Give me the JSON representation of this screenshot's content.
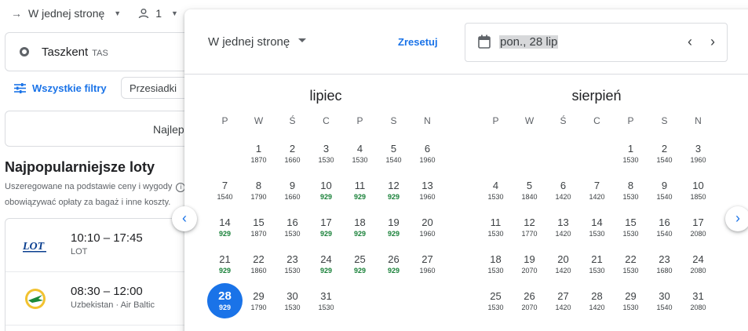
{
  "topbar": {
    "trip_type": "W jednej stronę",
    "passengers": "1"
  },
  "search": {
    "origin_city": "Taszkent",
    "origin_code": "TAS"
  },
  "filters": {
    "all_filters": "Wszystkie filtry",
    "stops_chip": "Przesiadki"
  },
  "sort": {
    "best_label": "Najlep"
  },
  "popular": {
    "title": "Najpopularniejsze loty",
    "subtitle_1": "Uszeregowane na podstawie ceny i wygody",
    "subtitle_2": "obowiązywać opłaty za bagaż i inne koszty."
  },
  "flights": [
    {
      "times": "10:10 – 17:45",
      "airline": "LOT",
      "logo": "lot-logo"
    },
    {
      "times": "08:30 – 12:00",
      "airline": "Uzbekistan · Air Baltic",
      "logo": "uzbekistan-airways-logo"
    }
  ],
  "calendar": {
    "trip_type": "W jednej stronę",
    "reset": "Zresetuj",
    "selected_date": "pon., 28 lip",
    "weekdays": [
      "P",
      "W",
      "Ś",
      "C",
      "P",
      "S",
      "N"
    ],
    "colors": {
      "accent": "#1a73e8",
      "cheap": "#188038"
    },
    "months": [
      {
        "name": "lipiec",
        "offset": 1,
        "days": [
          {
            "d": "1",
            "p": "1870"
          },
          {
            "d": "2",
            "p": "1660"
          },
          {
            "d": "3",
            "p": "1530"
          },
          {
            "d": "4",
            "p": "1530"
          },
          {
            "d": "5",
            "p": "1540"
          },
          {
            "d": "6",
            "p": "1960"
          },
          {
            "d": "7",
            "p": "1540"
          },
          {
            "d": "8",
            "p": "1790"
          },
          {
            "d": "9",
            "p": "1660"
          },
          {
            "d": "10",
            "p": "929",
            "cheap": true
          },
          {
            "d": "11",
            "p": "929",
            "cheap": true
          },
          {
            "d": "12",
            "p": "929",
            "cheap": true
          },
          {
            "d": "13",
            "p": "1960"
          },
          {
            "d": "14",
            "p": "929",
            "cheap": true
          },
          {
            "d": "15",
            "p": "1870"
          },
          {
            "d": "16",
            "p": "1530"
          },
          {
            "d": "17",
            "p": "929",
            "cheap": true
          },
          {
            "d": "18",
            "p": "929",
            "cheap": true
          },
          {
            "d": "19",
            "p": "929",
            "cheap": true
          },
          {
            "d": "20",
            "p": "1960"
          },
          {
            "d": "21",
            "p": "929",
            "cheap": true
          },
          {
            "d": "22",
            "p": "1860"
          },
          {
            "d": "23",
            "p": "1530"
          },
          {
            "d": "24",
            "p": "929",
            "cheap": true
          },
          {
            "d": "25",
            "p": "929",
            "cheap": true
          },
          {
            "d": "26",
            "p": "929",
            "cheap": true
          },
          {
            "d": "27",
            "p": "1960"
          },
          {
            "d": "28",
            "p": "929",
            "selected": true
          },
          {
            "d": "29",
            "p": "1790"
          },
          {
            "d": "30",
            "p": "1530"
          },
          {
            "d": "31",
            "p": "1530"
          }
        ]
      },
      {
        "name": "sierpień",
        "offset": 4,
        "days": [
          {
            "d": "1",
            "p": "1530"
          },
          {
            "d": "2",
            "p": "1540"
          },
          {
            "d": "3",
            "p": "1960"
          },
          {
            "d": "4",
            "p": "1530"
          },
          {
            "d": "5",
            "p": "1840"
          },
          {
            "d": "6",
            "p": "1420"
          },
          {
            "d": "7",
            "p": "1420"
          },
          {
            "d": "8",
            "p": "1530"
          },
          {
            "d": "9",
            "p": "1540"
          },
          {
            "d": "10",
            "p": "1850"
          },
          {
            "d": "11",
            "p": "1530"
          },
          {
            "d": "12",
            "p": "1770"
          },
          {
            "d": "13",
            "p": "1420"
          },
          {
            "d": "14",
            "p": "1530"
          },
          {
            "d": "15",
            "p": "1530"
          },
          {
            "d": "16",
            "p": "1540"
          },
          {
            "d": "17",
            "p": "2080"
          },
          {
            "d": "18",
            "p": "1530"
          },
          {
            "d": "19",
            "p": "2070"
          },
          {
            "d": "20",
            "p": "1420"
          },
          {
            "d": "21",
            "p": "1530"
          },
          {
            "d": "22",
            "p": "1530"
          },
          {
            "d": "23",
            "p": "1680"
          },
          {
            "d": "24",
            "p": "2080"
          },
          {
            "d": "25",
            "p": "1530"
          },
          {
            "d": "26",
            "p": "2070"
          },
          {
            "d": "27",
            "p": "1420"
          },
          {
            "d": "28",
            "p": "1420"
          },
          {
            "d": "29",
            "p": "1530"
          },
          {
            "d": "30",
            "p": "1540"
          },
          {
            "d": "31",
            "p": "2080"
          }
        ]
      }
    ]
  }
}
